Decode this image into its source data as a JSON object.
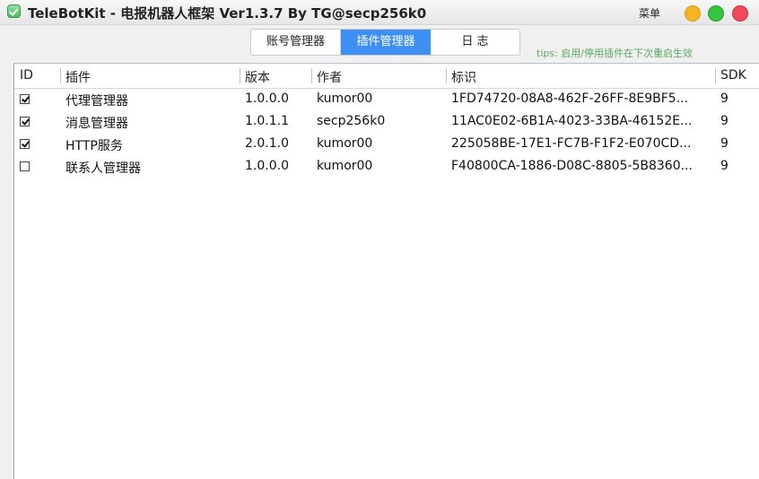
{
  "window": {
    "title": "TeleBotKit - 电报机器人框架 Ver1.3.7 By TG@secp256k0",
    "menu_label": "菜单"
  },
  "tabs": [
    {
      "label": "账号管理器",
      "active": false
    },
    {
      "label": "插件管理器",
      "active": true
    },
    {
      "label": "日 志",
      "active": false
    }
  ],
  "tips": "tips: 启用/停用插件在下次重启生效",
  "colors": {
    "active_tab": "#3d8ff3",
    "tips": "#59a85f"
  },
  "table": {
    "columns": [
      "ID",
      "插件",
      "版本",
      "作者",
      "标识",
      "SDK"
    ],
    "rows": [
      {
        "enabled": true,
        "name": "代理管理器",
        "version": "1.0.0.0",
        "author": "kumor00",
        "id": "1FD74720-08A8-462F-26FF-8E9BF5...",
        "sdk": "9"
      },
      {
        "enabled": true,
        "name": "消息管理器",
        "version": "1.0.1.1",
        "author": "secp256k0",
        "id": "11AC0E02-6B1A-4023-33BA-46152E...",
        "sdk": "9"
      },
      {
        "enabled": true,
        "name": "HTTP服务",
        "version": "2.0.1.0",
        "author": "kumor00",
        "id": "225058BE-17E1-FC7B-F1F2-E070CD...",
        "sdk": "9"
      },
      {
        "enabled": false,
        "name": "联系人管理器",
        "version": "1.0.0.0",
        "author": "kumor00",
        "id": "F40800CA-1886-D08C-8805-5B8360...",
        "sdk": "9"
      }
    ]
  }
}
